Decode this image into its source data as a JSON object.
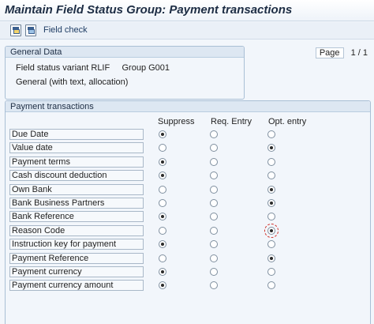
{
  "title": "Maintain Field Status Group: Payment transactions",
  "toolbar": {
    "field_check_label": "Field check",
    "icons": [
      "save-variant-icon",
      "copy-variant-icon"
    ]
  },
  "general_data": {
    "header": "General Data",
    "line1": "Field status variant RLIF     Group G001",
    "line2": "General (with text, allocation)"
  },
  "pager": {
    "label": "Page",
    "value": "1 / 1"
  },
  "payment_transactions": {
    "header": "Payment transactions",
    "columns": [
      "Suppress",
      "Req. Entry",
      "Opt. entry"
    ],
    "rows": [
      {
        "label": "Due Date",
        "selected": "Suppress"
      },
      {
        "label": "Value date",
        "selected": "Opt. entry"
      },
      {
        "label": "Payment terms",
        "selected": "Suppress"
      },
      {
        "label": "Cash discount deduction",
        "selected": "Suppress"
      },
      {
        "label": "Own Bank",
        "selected": "Opt. entry"
      },
      {
        "label": "Bank Business Partners",
        "selected": "Opt. entry"
      },
      {
        "label": "Bank Reference",
        "selected": "Suppress"
      },
      {
        "label": "Reason Code",
        "selected": "Opt. entry",
        "focused": true
      },
      {
        "label": "Instruction key for payment",
        "selected": "Suppress"
      },
      {
        "label": "Payment Reference",
        "selected": "Opt. entry"
      },
      {
        "label": "Payment currency",
        "selected": "Suppress"
      },
      {
        "label": "Payment currency amount",
        "selected": "Suppress"
      }
    ]
  }
}
